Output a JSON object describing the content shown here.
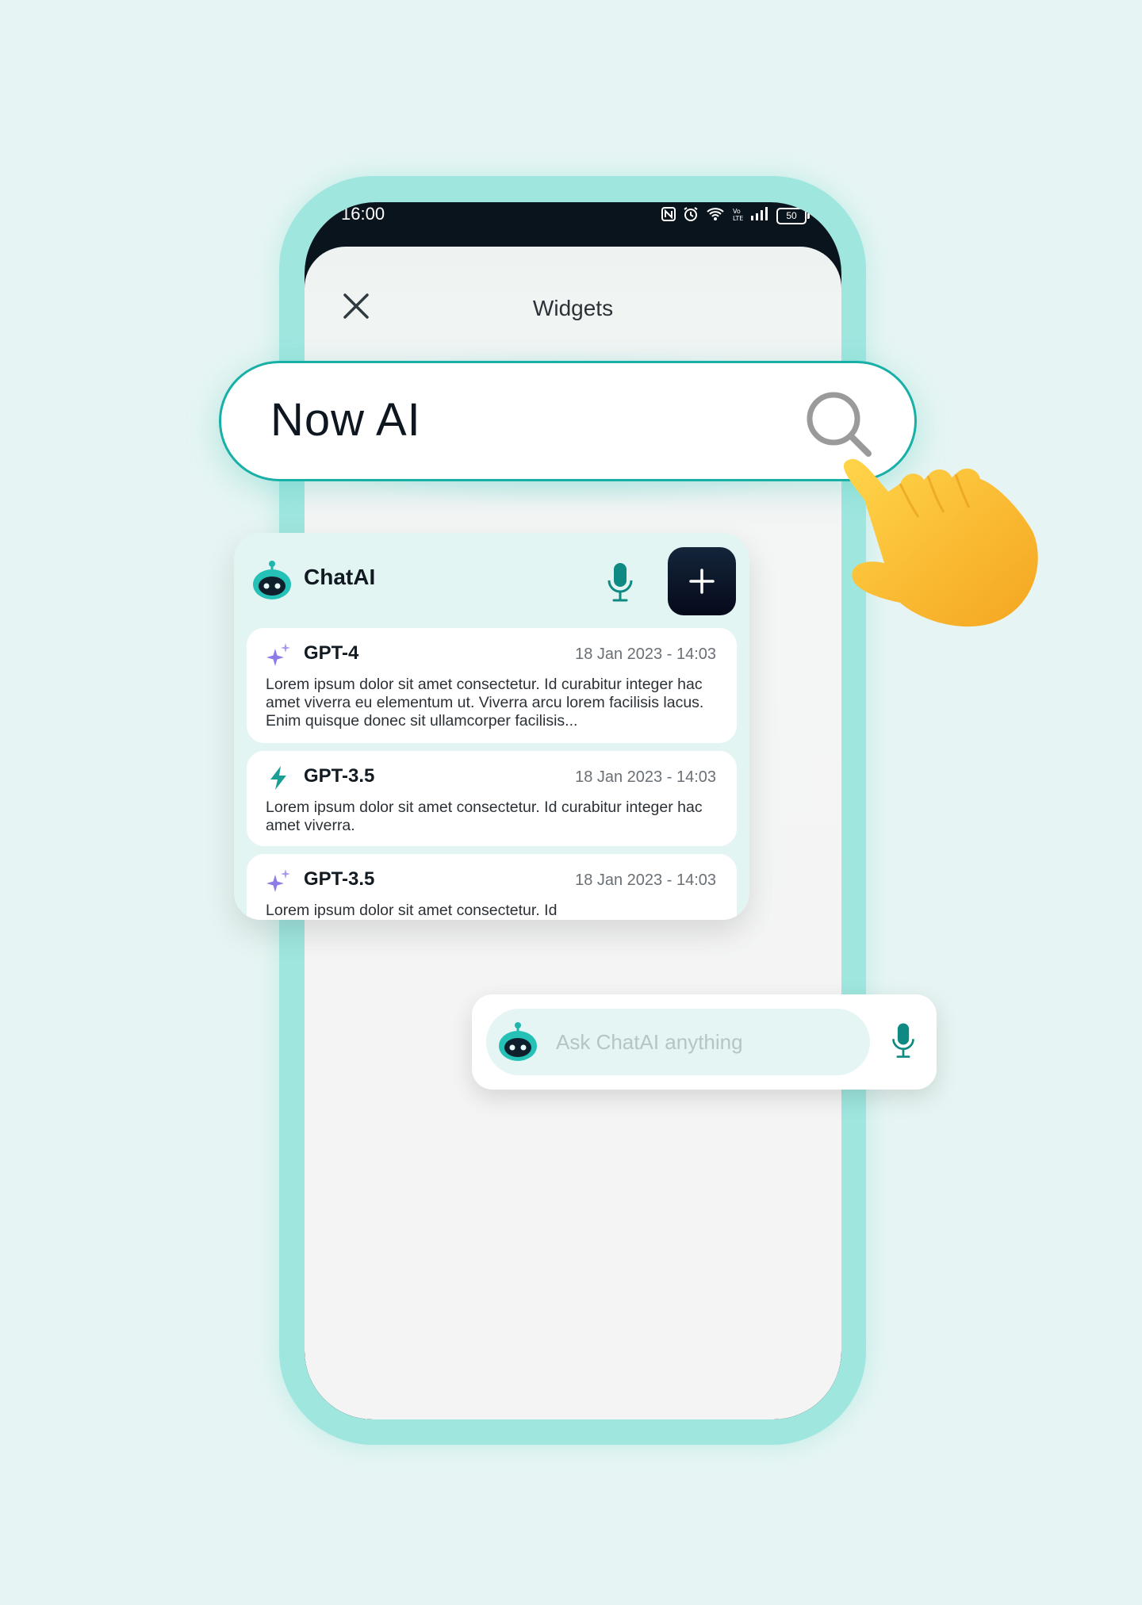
{
  "status_bar": {
    "time": "16:00",
    "battery": "50"
  },
  "sheet": {
    "title": "Widgets"
  },
  "search": {
    "query": "Now AI"
  },
  "chat_widget": {
    "title": "ChatAI",
    "messages": [
      {
        "model": "GPT-4",
        "time": "18 Jan 2023 - 14:03",
        "icon": "sparkle-icon",
        "body": "Lorem ipsum dolor sit amet consectetur. Id curabitur integer hac amet viverra eu elementum ut. Viverra arcu lorem facilisis lacus. Enim quisque donec sit ullamcorper facilisis..."
      },
      {
        "model": "GPT-3.5",
        "time": "18 Jan 2023 - 14:03",
        "icon": "bolt-icon",
        "body": "Lorem ipsum dolor sit amet consectetur. Id curabitur integer hac amet viverra."
      },
      {
        "model": "GPT-3.5",
        "time": "18 Jan 2023 - 14:03",
        "icon": "sparkle-icon",
        "body": "Lorem ipsum dolor sit amet consectetur. Id"
      }
    ]
  },
  "ask_widget": {
    "placeholder": "Ask ChatAI anything"
  },
  "colors": {
    "accent": "#18b0a6",
    "frame": "#9fe6df",
    "sparkle": "#8f7be6",
    "button": "#0b1428",
    "background": "#e6f5f3"
  }
}
